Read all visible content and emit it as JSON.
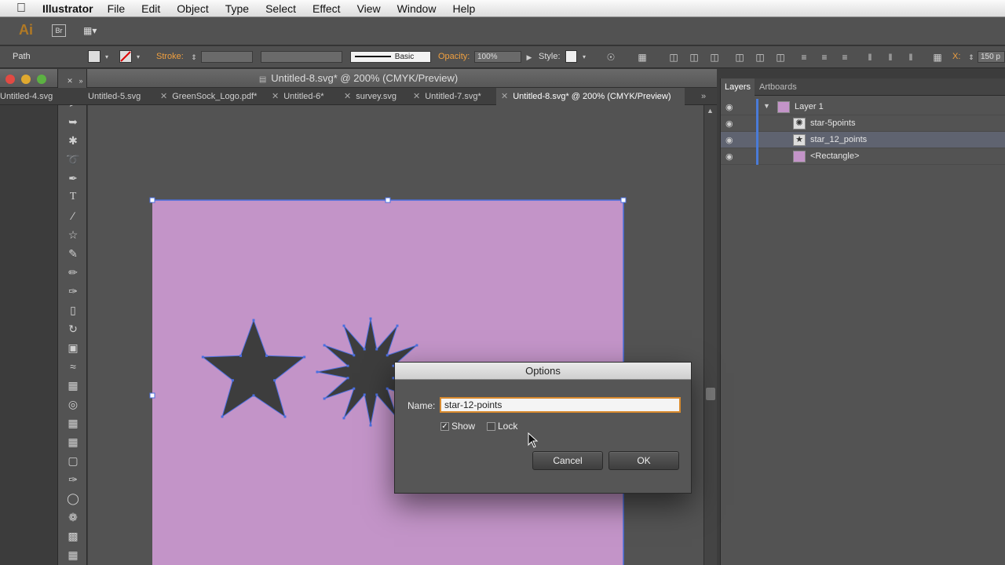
{
  "menubar": {
    "app_name": "Illustrator",
    "items": [
      "File",
      "Edit",
      "Object",
      "Type",
      "Select",
      "Effect",
      "View",
      "Window",
      "Help"
    ]
  },
  "appbar": {
    "logo": "Ai",
    "bridge": "Br"
  },
  "controlbar": {
    "selection_type": "Path",
    "stroke_label": "Stroke:",
    "brush_name": "Basic",
    "opacity_label": "Opacity:",
    "opacity_value": "100%",
    "style_label": "Style:",
    "x_label": "X:",
    "x_value": "150 p"
  },
  "document": {
    "title": "Untitled-8.svg* @ 200% (CMYK/Preview)",
    "tabs": [
      {
        "label": "Untitled-4.svg",
        "active": false
      },
      {
        "label": "Untitled-5.svg",
        "active": false
      },
      {
        "label": "GreenSock_Logo.pdf*",
        "active": false
      },
      {
        "label": "Untitled-6*",
        "active": false
      },
      {
        "label": "survey.svg",
        "active": false
      },
      {
        "label": "Untitled-7.svg*",
        "active": false
      },
      {
        "label": "Untitled-8.svg* @ 200% (CMYK/Preview)",
        "active": true
      }
    ],
    "artboard_color": "#c394c8",
    "shape_color": "#3d3d3d",
    "selection_color": "#4a6fe0"
  },
  "layers_panel": {
    "tabs": [
      "Layers",
      "Artboards"
    ],
    "layer_name": "Layer 1",
    "items": [
      {
        "name": "star-5points"
      },
      {
        "name": "star_12_points"
      },
      {
        "name": "<Rectangle>"
      }
    ]
  },
  "dialog": {
    "title": "Options",
    "name_label": "Name:",
    "name_value": "star-12-points",
    "show_label": "Show",
    "show_checked": true,
    "lock_label": "Lock",
    "lock_checked": false,
    "cancel_label": "Cancel",
    "ok_label": "OK"
  }
}
